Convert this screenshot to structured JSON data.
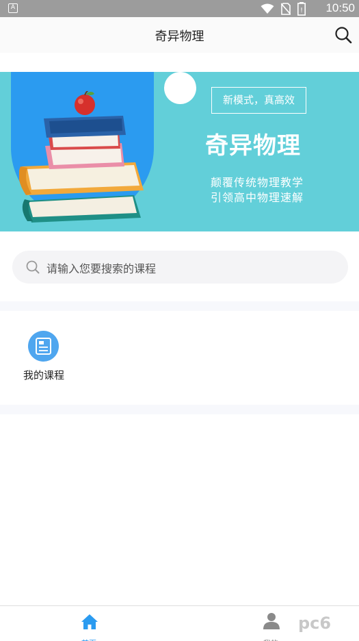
{
  "status_bar": {
    "sim_label": "A",
    "time": "10:50"
  },
  "header": {
    "title": "奇异物理",
    "search_icon": "search-icon"
  },
  "banner": {
    "tag": "新模式，真高效",
    "title": "奇异物理",
    "subtitle_line1": "颠覆传统物理教学",
    "subtitle_line2": "引领高中物理速解",
    "colors": {
      "background": "#62cfd9",
      "arch": "#2b9bf0"
    }
  },
  "search": {
    "placeholder": "请输入您要搜索的课程"
  },
  "courses": {
    "my_courses_label": "我的课程",
    "icon": "course-list-icon"
  },
  "bottom_nav": {
    "home_label": "首页",
    "mine_label": "我的",
    "active_color": "#2b9bf0"
  },
  "watermark": {
    "text": "pc6"
  }
}
